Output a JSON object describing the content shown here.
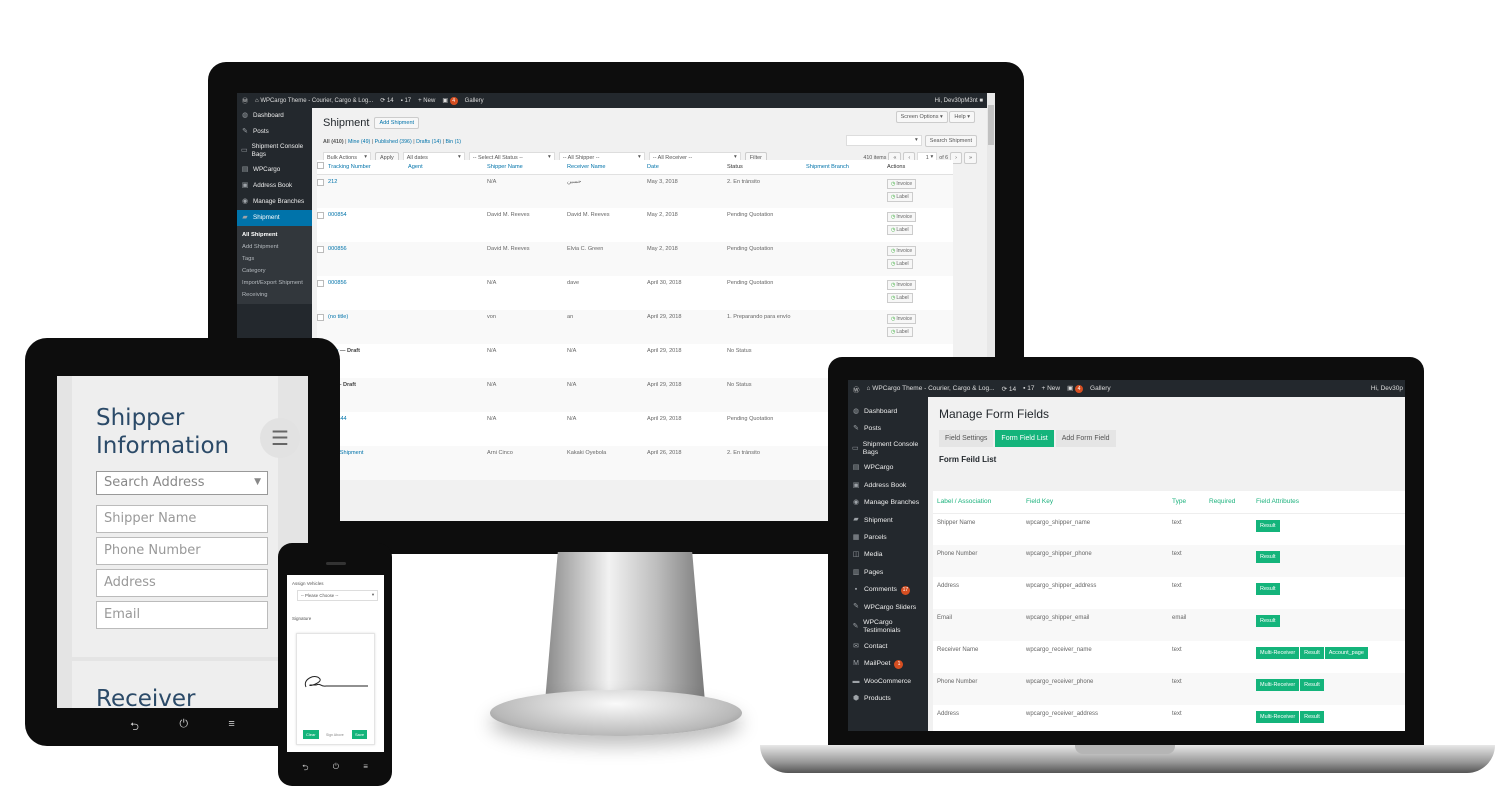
{
  "monitor": {
    "adminbar": {
      "site": "WPCargo Theme - Courier, Cargo & Log...",
      "updates": "14",
      "comments": "17",
      "new": "New",
      "badge": "4",
      "gallery": "Gallery",
      "greeting": "Hi, Dev30pM3nt"
    },
    "sidebar": {
      "items": [
        {
          "icon": "dashboard-icon",
          "label": "Dashboard"
        },
        {
          "icon": "pin-icon",
          "label": "Posts"
        },
        {
          "icon": "console-icon",
          "label": "Shipment Console Bags"
        },
        {
          "icon": "book-icon",
          "label": "WPCargo"
        },
        {
          "icon": "contact-icon",
          "label": "Address Book"
        },
        {
          "icon": "location-icon",
          "label": "Manage Branches"
        },
        {
          "icon": "truck-icon",
          "label": "Shipment",
          "active": true
        }
      ],
      "submenu": [
        "All Shipment",
        "Add Shipment",
        "Tags",
        "Category",
        "Import/Export Shipment",
        "Receiving"
      ]
    },
    "page_title": "Shipment",
    "add_button": "Add Shipment",
    "screen_options": "Screen Options ▾",
    "help": "Help ▾",
    "views": {
      "all": "All (410)",
      "mine": "Mine (49)",
      "published": "Published (396)",
      "drafts": "Drafts (14)",
      "bin": "Bin (1)"
    },
    "search_button": "Search Shipment",
    "search_value": "",
    "filters": {
      "bulk": "Bulk Actions",
      "apply": "Apply",
      "dates": "All dates",
      "status": "-- Select All Status --",
      "shipper": "-- All Shipper --",
      "receiver": "-- All Receiver --",
      "filter": "Filter"
    },
    "pagination": {
      "items": "410 items",
      "page": "1",
      "of": "of 6"
    },
    "columns": [
      "Tracking Number",
      "Agent",
      "Shipper Name",
      "Receiver Name",
      "Date",
      "Status",
      "Shipment Branch",
      "Actions"
    ],
    "action_labels": {
      "invoice": "Invoice",
      "label": "Label"
    },
    "rows": [
      {
        "tracking": "212",
        "agent": "",
        "shipper": "N/A",
        "receiver": "حسين",
        "date": "May 3, 2018",
        "status": "2. En tránsito",
        "actions": true
      },
      {
        "tracking": "000854",
        "agent": "",
        "shipper": "David M. Reeves",
        "receiver": "David M. Reeves",
        "date": "May 2, 2018",
        "status": "Pending Quotation",
        "actions": true
      },
      {
        "tracking": "000856",
        "agent": "",
        "shipper": "David M. Reeves",
        "receiver": "Elvia C. Green",
        "date": "May 2, 2018",
        "status": "Pending Quotation",
        "actions": true
      },
      {
        "tracking": "000856",
        "agent": "",
        "shipper": "N/A",
        "receiver": "dave",
        "date": "April 30, 2018",
        "status": "Pending Quotation",
        "actions": true
      },
      {
        "tracking": "(no title)",
        "agent": "",
        "shipper": "von",
        "receiver": "an",
        "date": "April 29, 2018",
        "status": "1. Preparando para envío",
        "actions": true
      },
      {
        "tracking": "new",
        "draft": "— Draft",
        "agent": "",
        "shipper": "N/A",
        "receiver": "N/A",
        "date": "April 29, 2018",
        "status": "No Status"
      },
      {
        "tracking": "hh",
        "draft": "— Draft",
        "agent": "",
        "shipper": "N/A",
        "receiver": "N/A",
        "date": "April 29, 2018",
        "status": "No Status"
      },
      {
        "tracking": "000844",
        "agent": "",
        "shipper": "N/A",
        "receiver": "N/A",
        "date": "April 29, 2018",
        "status": "Pending Quotation"
      },
      {
        "tracking": "Test Shipment",
        "agent": "",
        "shipper": "Arni Cinco",
        "receiver": "Kakaki Oyebola",
        "date": "April 26, 2018",
        "status": "2. En tránsito"
      }
    ]
  },
  "tablet": {
    "heading": "Shipper Information",
    "search_placeholder": "Search Address",
    "fields": [
      "Shipper Name",
      "Phone Number",
      "Address",
      "Email"
    ],
    "next_heading": "Receiver",
    "nav": {
      "back": "⮌",
      "power": "⏻",
      "menu": "≡"
    }
  },
  "phone": {
    "vehicles_label": "Assign Vehicles",
    "vehicles_value": "-- Please Choose --",
    "signature_label": "Signature",
    "clear": "Clear",
    "sign_above": "Sign Above",
    "save": "Save",
    "nav": {
      "back": "⮌",
      "power": "⏻",
      "menu": "≡"
    }
  },
  "laptop": {
    "adminbar": {
      "site": "WPCargo Theme - Courier, Cargo & Log...",
      "updates": "14",
      "comments": "17",
      "new": "New",
      "badge": "4",
      "gallery": "Gallery",
      "greeting": "Hi, Dev30p"
    },
    "sidebar": [
      {
        "icon": "dashboard-icon",
        "label": "Dashboard"
      },
      {
        "icon": "pin-icon",
        "label": "Posts"
      },
      {
        "icon": "console-icon",
        "label": "Shipment Console Bags"
      },
      {
        "icon": "book-icon",
        "label": "WPCargo"
      },
      {
        "icon": "contact-icon",
        "label": "Address Book"
      },
      {
        "icon": "location-icon",
        "label": "Manage Branches"
      },
      {
        "icon": "truck-icon",
        "label": "Shipment"
      },
      {
        "icon": "grid-icon",
        "label": "Parcels"
      },
      {
        "icon": "media-icon",
        "label": "Media"
      },
      {
        "icon": "pages-icon",
        "label": "Pages"
      },
      {
        "icon": "comment-icon",
        "label": "Comments",
        "badge": "17"
      },
      {
        "icon": "pin-icon",
        "label": "WPCargo Sliders"
      },
      {
        "icon": "pin-icon",
        "label": "WPCargo Testimonials"
      },
      {
        "icon": "mail-icon",
        "label": "Contact"
      },
      {
        "icon": "mailpoet-icon",
        "label": "MailPoet",
        "badge": "1"
      },
      {
        "icon": "woo-icon",
        "label": "WooCommerce"
      },
      {
        "icon": "box-icon",
        "label": "Products"
      }
    ],
    "page_title": "Manage Form Fields",
    "tabs": [
      {
        "label": "Field Settings"
      },
      {
        "label": "Form Field List",
        "active": true
      },
      {
        "label": "Add Form Field"
      }
    ],
    "section_title": "Form Feild List",
    "columns": [
      "Label / Association",
      "Field Key",
      "Type",
      "Required",
      "Field Attributes"
    ],
    "rows": [
      {
        "label": "Shipper Name",
        "key": "wpcargo_shipper_name",
        "type": "text",
        "required": "",
        "attrs": [
          "Result"
        ]
      },
      {
        "label": "Phone Number",
        "key": "wpcargo_shipper_phone",
        "type": "text",
        "required": "",
        "attrs": [
          "Result"
        ]
      },
      {
        "label": "Address",
        "key": "wpcargo_shipper_address",
        "type": "text",
        "required": "",
        "attrs": [
          "Result"
        ]
      },
      {
        "label": "Email",
        "key": "wpcargo_shipper_email",
        "type": "email",
        "required": "",
        "attrs": [
          "Result"
        ]
      },
      {
        "label": "Receiver Name",
        "key": "wpcargo_receiver_name",
        "type": "text",
        "required": "",
        "attrs": [
          "Multi-Receiver",
          "Result",
          "Account_page"
        ]
      },
      {
        "label": "Phone Number",
        "key": "wpcargo_receiver_phone",
        "type": "text",
        "required": "",
        "attrs": [
          "Multi-Receiver",
          "Result"
        ]
      },
      {
        "label": "Address",
        "key": "wpcargo_receiver_address",
        "type": "text",
        "required": "",
        "attrs": [
          "Multi-Receiver",
          "Result"
        ]
      },
      {
        "label": "Email",
        "key": "wpcargo_receiver_email",
        "type": "email",
        "required": "",
        "attrs": [
          "Multi-Receiver",
          "Result"
        ]
      }
    ]
  },
  "colors": {
    "wp_dark": "#23282d",
    "wp_blue": "#0073aa",
    "green": "#14b47b",
    "heading_blue": "#2b4a68",
    "badge_orange": "#d54e21"
  }
}
